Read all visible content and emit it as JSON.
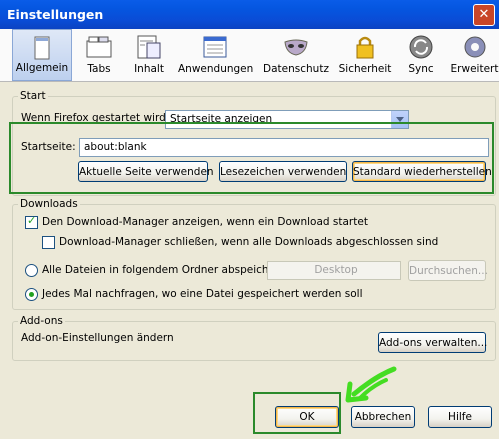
{
  "window": {
    "title": "Einstellungen",
    "close_glyph": "✕"
  },
  "toolbar": {
    "items": [
      {
        "label": "Allgemein",
        "icon": "window-icon",
        "selected": true
      },
      {
        "label": "Tabs",
        "icon": "tabs-icon"
      },
      {
        "label": "Inhalt",
        "icon": "content-icon"
      },
      {
        "label": "Anwendungen",
        "icon": "applications-icon"
      },
      {
        "label": "Datenschutz",
        "icon": "mask-icon"
      },
      {
        "label": "Sicherheit",
        "icon": "lock-icon"
      },
      {
        "label": "Sync",
        "icon": "sync-icon"
      },
      {
        "label": "Erweitert",
        "icon": "gear-icon"
      }
    ]
  },
  "start": {
    "group_label": "Start",
    "when_label": "Wenn Firefox gestartet wird:",
    "when_value": "Startseite anzeigen",
    "homepage_label": "Startseite:",
    "homepage_value": "about:blank",
    "btn_current": "Aktuelle Seite verwenden",
    "btn_bookmark": "Lesezeichen verwenden",
    "btn_default": "Standard wiederherstellen"
  },
  "downloads": {
    "group_label": "Downloads",
    "show_manager": "Den Download-Manager anzeigen, wenn ein Download startet",
    "show_manager_checked": true,
    "close_manager": "Download-Manager schließen, wenn alle Downloads abgeschlossen sind",
    "close_manager_checked": false,
    "save_all": "Alle Dateien in folgendem Ordner abspeichern:",
    "folder_value": "Desktop",
    "browse": "Durchsuchen...",
    "ask_always": "Jedes Mal nachfragen, wo eine Datei gespeichert werden soll"
  },
  "addons": {
    "group_label": "Add-ons",
    "change_text": "Add-on-Einstellungen ändern",
    "manage_btn": "Add-ons verwalten..."
  },
  "footer": {
    "ok": "OK",
    "cancel": "Abbrechen",
    "help": "Hilfe"
  },
  "colors": {
    "annotation": "#2b8a2b",
    "arrow": "#44dd22"
  }
}
